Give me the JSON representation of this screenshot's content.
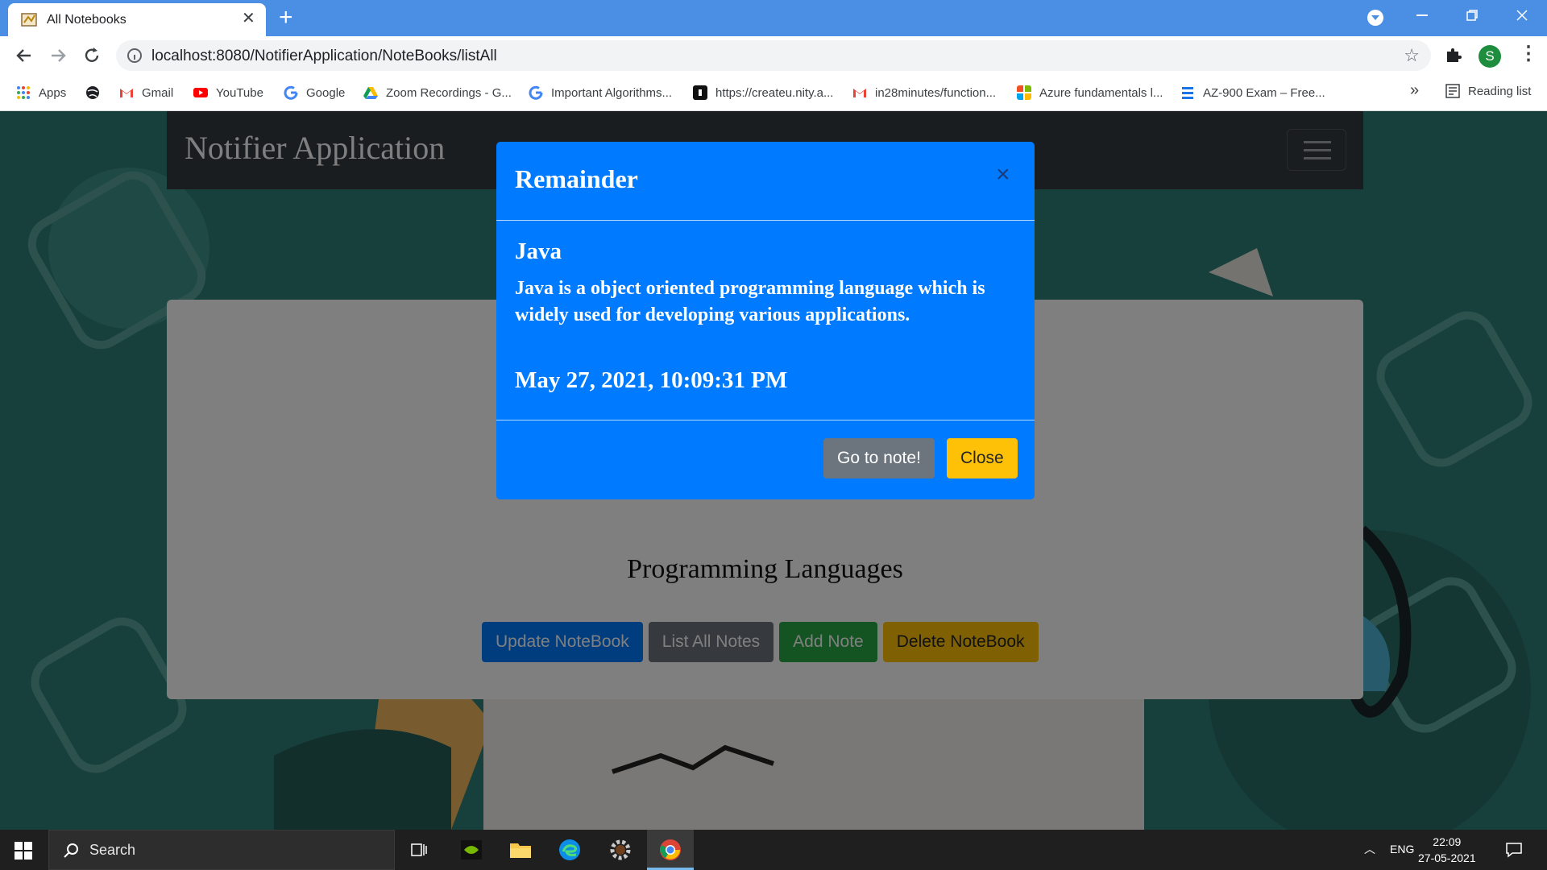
{
  "browser": {
    "tab_title": "All Notebooks",
    "new_tab_symbol": "+",
    "close_symbol": "✕",
    "url": "localhost:8080/NotifierApplication/NoteBooks/listAll",
    "profile_initial": "S",
    "bookmarks": [
      {
        "label": "Apps",
        "icon": "apps-grid-icon",
        "color": "#ea4335"
      },
      {
        "label": "",
        "icon": "globe-icon",
        "color": "#202124"
      },
      {
        "label": "Gmail",
        "icon": "gmail-icon",
        "color": "#ea4335"
      },
      {
        "label": "YouTube",
        "icon": "youtube-icon",
        "color": "#ff0000"
      },
      {
        "label": "Google",
        "icon": "google-icon",
        "color": "#4285f4"
      },
      {
        "label": "Zoom Recordings - G...",
        "icon": "drive-icon",
        "color": "#0f9d58"
      },
      {
        "label": "Important Algorithms...",
        "icon": "google-icon",
        "color": "#4285f4"
      },
      {
        "label": "https://createu.nity.a...",
        "icon": "site-icon",
        "color": "#111111"
      },
      {
        "label": "in28minutes/function...",
        "icon": "gmail-icon",
        "color": "#ea4335"
      },
      {
        "label": "Azure fundamentals l...",
        "icon": "microsoft-icon",
        "color": "#f25022"
      },
      {
        "label": "AZ-900 Exam – Free...",
        "icon": "list-icon",
        "color": "#1a73e8"
      }
    ],
    "bookmarks_more": "»",
    "reading_list": "Reading list"
  },
  "app": {
    "brand": "Notifier Application",
    "notebook_title": "Programming Languages",
    "buttons": {
      "update": "Update NoteBook",
      "list": "List All Notes",
      "add": "Add Note",
      "delete": "Delete NoteBook"
    }
  },
  "modal": {
    "title": "Remainder",
    "close_symbol": "×",
    "note_title": "Java",
    "note_body": "Java is a object oriented programming language which is widely used for developing various applications.",
    "note_date": "May 27, 2021, 10:09:31 PM",
    "goto_label": "Go to note!",
    "close_label": "Close"
  },
  "taskbar": {
    "search_label": "Search",
    "language": "ENG",
    "time": "22:09",
    "date": "27-05-2021"
  },
  "colors": {
    "primary": "#007bff",
    "secondary": "#6c757d",
    "success": "#28a745",
    "warning": "#ffc107",
    "navbar": "#343a40"
  }
}
